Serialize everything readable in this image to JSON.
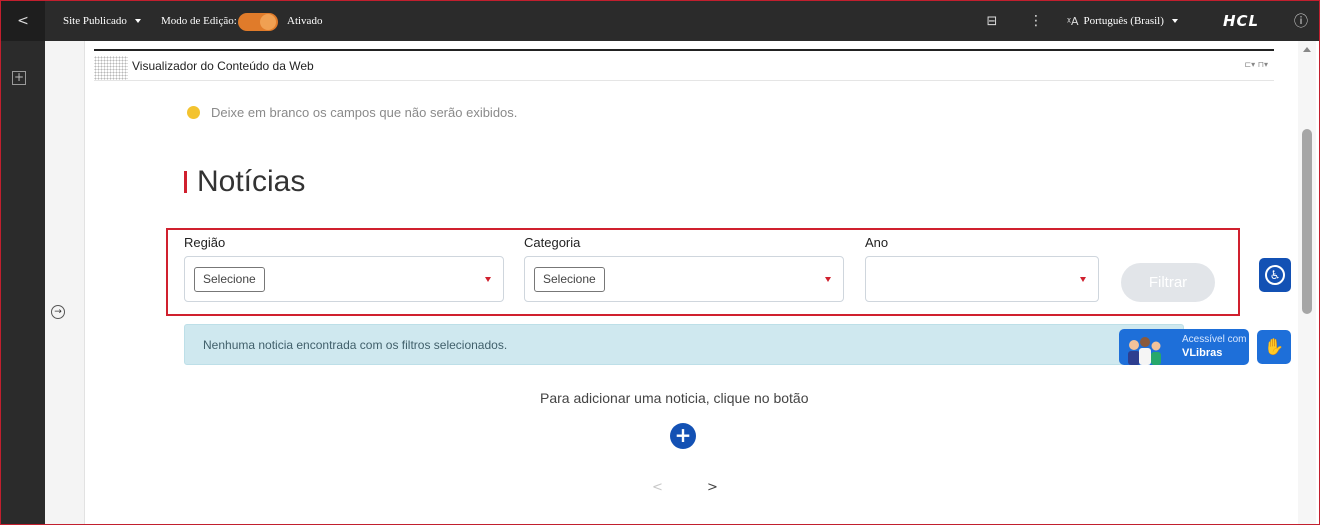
{
  "topbar": {
    "back_icon": "chevron-left-icon",
    "back_glyph": "<",
    "site_label": "Site Publicado",
    "edit_mode_label": "Modo de Edição:",
    "edit_mode_state": "Ativado",
    "toggle_color": "#e07b2a",
    "layout_icon_glyph": "⊟",
    "more_icon_glyph": "⋮",
    "language_icon_glyph": "ᵡA",
    "language_label": "Português (Brasil)",
    "brand": "HCL",
    "info_icon_glyph": "ⓘ"
  },
  "leftbar": {
    "add_icon": "add-page-icon",
    "add_glyph": "+"
  },
  "gutter": {
    "expand_glyph": "→"
  },
  "portlet": {
    "title": "Visualizador do Conteúdo da Web",
    "menu_glyph": "⊏▾ ⊓▾"
  },
  "hint": {
    "text": "Deixe em branco os campos que não serão exibidos.",
    "dot_color": "#f3c32f"
  },
  "section": {
    "title": "Notícias",
    "accent": "#d0202e"
  },
  "filters": {
    "region": {
      "label": "Região",
      "value": "Selecione"
    },
    "category": {
      "label": "Categoria",
      "value": "Selecione"
    },
    "year": {
      "label": "Ano",
      "value": ""
    },
    "filter_button": "Filtrar"
  },
  "alert": {
    "text": "Nenhuma noticia encontrada com os filtros selecionados."
  },
  "add": {
    "text": "Para adicionar uma noticia, clique no botão",
    "glyph": "+",
    "color": "#1351b4"
  },
  "pager": {
    "prev": "<",
    "next": ">"
  },
  "widgets": {
    "accessibility_glyph": "♿",
    "vlibras_small": "Acessível com",
    "vlibras_big": "VLibras",
    "hands_glyph": "✋"
  }
}
